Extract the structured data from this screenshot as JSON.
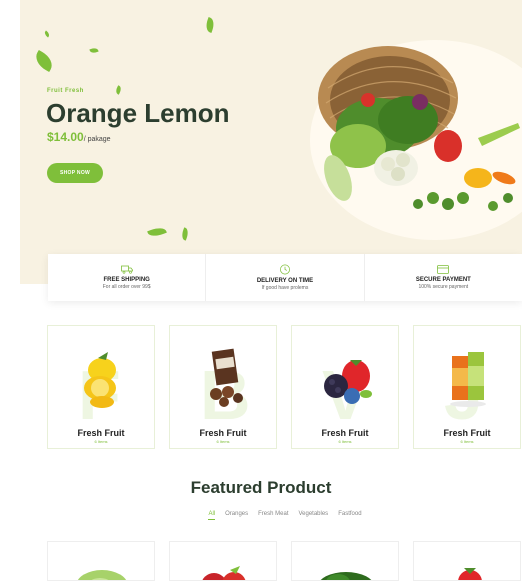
{
  "hero": {
    "eyebrow": "Fruit Fresh",
    "title": "Orange Lemon",
    "price": "$14.00",
    "unit": "/ pakage",
    "cta": "SHOP NOW"
  },
  "features": [
    {
      "icon": "truck-icon",
      "title": "FREE SHIPPING",
      "subtitle": "For all order over 99$"
    },
    {
      "icon": "clock-icon",
      "title": "DELIVERY ON TIME",
      "subtitle": "If good have prolems"
    },
    {
      "icon": "card-icon",
      "title": "SECURE PAYMENT",
      "subtitle": "100% secure payment"
    }
  ],
  "categories": [
    {
      "title": "Fresh Fruit",
      "subtitle": "6 Items",
      "watermark": "F"
    },
    {
      "title": "Fresh Fruit",
      "subtitle": "6 Items",
      "watermark": "B"
    },
    {
      "title": "Fresh Fruit",
      "subtitle": "6 Items",
      "watermark": "V"
    },
    {
      "title": "Fresh Fruit",
      "subtitle": "6 Items",
      "watermark": "J"
    }
  ],
  "featured": {
    "title": "Featured Product",
    "filters": [
      "All",
      "Oranges",
      "Fresh Meat",
      "Vegetables",
      "Fastfood"
    ],
    "active_filter": "All"
  },
  "colors": {
    "accent": "#7fbf3a",
    "hero_bg": "#f8f2e2",
    "heading": "#2c3e2f"
  }
}
